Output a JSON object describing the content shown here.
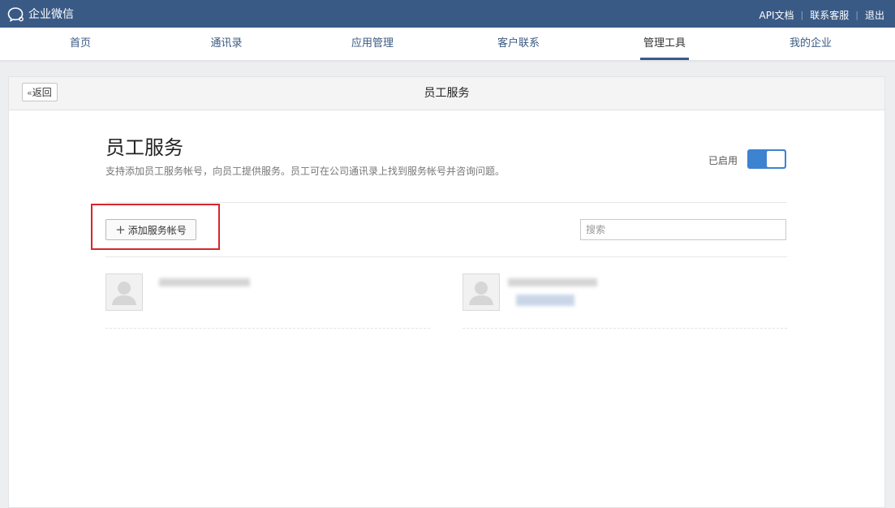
{
  "header": {
    "logo_text": "企业微信",
    "links": [
      "API文档",
      "联系客服",
      "退出"
    ]
  },
  "nav": {
    "items": [
      {
        "label": "首页"
      },
      {
        "label": "通讯录"
      },
      {
        "label": "应用管理"
      },
      {
        "label": "客户联系"
      },
      {
        "label": "管理工具",
        "active": true
      },
      {
        "label": "我的企业"
      }
    ]
  },
  "panel": {
    "back_label": "返回",
    "title": "员工服务",
    "section_title": "员工服务",
    "description": "支持添加员工服务帐号，向员工提供服务。员工可在公司通讯录上找到服务帐号并咨询问题。",
    "status_label": "已启用",
    "toggle_on": true,
    "add_button_label": "添加服务帐号",
    "search_placeholder": "搜索"
  },
  "accounts": [
    {
      "name": "(redacted)"
    },
    {
      "name": "(redacted)"
    }
  ],
  "icons": {
    "logo": "wecom-logo-icon",
    "back": "double-chevron-left-icon",
    "add": "plus-icon",
    "avatar": "default-user-avatar-icon"
  },
  "colors": {
    "topbar": "#3a5a86",
    "accent": "#3d83cf",
    "highlight": "#d9252a"
  }
}
